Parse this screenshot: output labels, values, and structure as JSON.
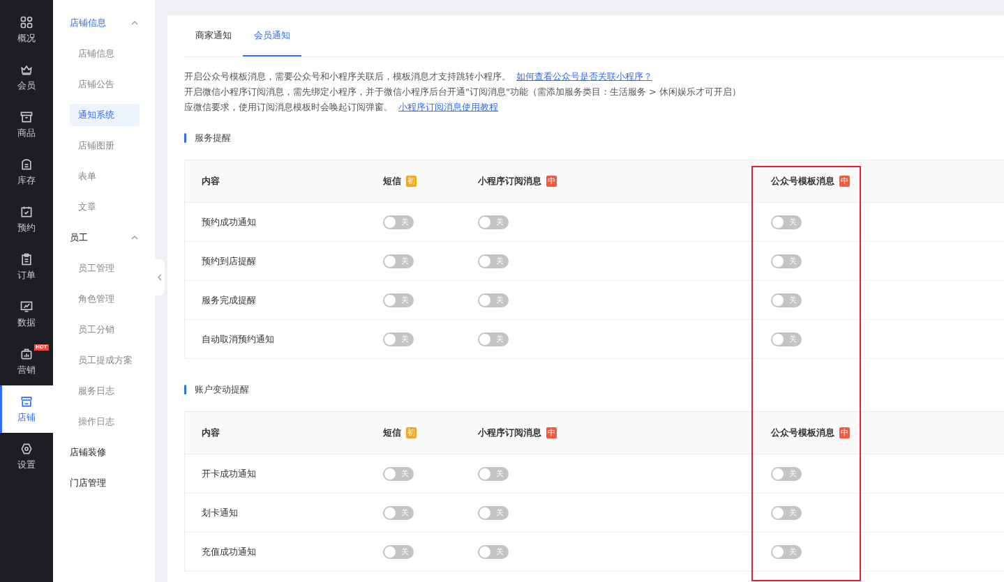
{
  "rail": [
    {
      "label": "概况",
      "selected": false
    },
    {
      "label": "会员",
      "selected": false
    },
    {
      "label": "商品",
      "selected": false
    },
    {
      "label": "库存",
      "selected": false
    },
    {
      "label": "预约",
      "selected": false
    },
    {
      "label": "订单",
      "selected": false
    },
    {
      "label": "数据",
      "selected": false
    },
    {
      "label": "营销",
      "selected": false,
      "badge": "HOT"
    },
    {
      "label": "店铺",
      "selected": true
    },
    {
      "label": "设置",
      "selected": false
    }
  ],
  "submenu": [
    {
      "label": "店铺信息",
      "selected": true,
      "expanded": true,
      "children": [
        {
          "label": "店铺信息",
          "selected": false
        },
        {
          "label": "店铺公告",
          "selected": false
        },
        {
          "label": "通知系统",
          "selected": true
        },
        {
          "label": "店铺图册",
          "selected": false
        },
        {
          "label": "表单",
          "selected": false
        },
        {
          "label": "文章",
          "selected": false
        }
      ]
    },
    {
      "label": "员工",
      "selected": false,
      "expanded": true,
      "children": [
        {
          "label": "员工管理",
          "selected": false
        },
        {
          "label": "角色管理",
          "selected": false
        },
        {
          "label": "员工分销",
          "selected": false
        },
        {
          "label": "员工提成方案",
          "selected": false
        },
        {
          "label": "服务日志",
          "selected": false
        },
        {
          "label": "操作日志",
          "selected": false
        }
      ]
    },
    {
      "label": "店铺装修",
      "selected": false
    },
    {
      "label": "门店管理",
      "selected": false
    }
  ],
  "tabs": [
    {
      "label": "商家通知",
      "selected": false
    },
    {
      "label": "会员通知",
      "selected": true
    }
  ],
  "notices": [
    {
      "text": "开启公众号模板消息，需要公众号和小程序关联后，模板消息才支持跳转小程序。",
      "link": "如何查看公众号是否关联小程序？"
    },
    {
      "text": "开启微信小程序订阅消息，需先绑定小程序，并于微信小程序后台开通\"订阅消息\"功能（需添加服务类目：生活服务 > 休闲娱乐才可开启）"
    },
    {
      "text": "应微信要求，使用订阅消息模板时会唤起订阅弹窗。",
      "link": "小程序订阅消息使用教程"
    }
  ],
  "sections": [
    {
      "title": "服务提醒",
      "columns": [
        {
          "label": "内容"
        },
        {
          "label": "短信",
          "badge": "初",
          "color": "#f5a623"
        },
        {
          "label": "小程序订阅消息",
          "badge": "中",
          "color": "#f5583a"
        },
        {
          "label": "公众号模板消息",
          "badge": "中",
          "color": "#f5583a"
        }
      ],
      "rows": [
        {
          "name": "预约成功通知",
          "toggles": [
            {
              "on": false,
              "label": "关"
            },
            {
              "on": false,
              "label": "关"
            },
            {
              "on": false,
              "label": "关"
            }
          ]
        },
        {
          "name": "预约到店提醒",
          "toggles": [
            {
              "on": false,
              "label": "关"
            },
            {
              "on": false,
              "label": "关"
            },
            {
              "on": false,
              "label": "关"
            }
          ]
        },
        {
          "name": "服务完成提醒",
          "toggles": [
            {
              "on": false,
              "label": "关"
            },
            {
              "on": false,
              "label": "关"
            },
            {
              "on": false,
              "label": "关"
            }
          ]
        },
        {
          "name": "自动取消预约通知",
          "toggles": [
            {
              "on": false,
              "label": "关"
            },
            {
              "on": false,
              "label": "关"
            },
            {
              "on": false,
              "label": "关"
            }
          ]
        }
      ]
    },
    {
      "title": "账户变动提醒",
      "columns": [
        {
          "label": "内容"
        },
        {
          "label": "短信",
          "badge": "初",
          "color": "#f5a623"
        },
        {
          "label": "小程序订阅消息",
          "badge": "中",
          "color": "#f5583a"
        },
        {
          "label": "公众号模板消息",
          "badge": "中",
          "color": "#f5583a"
        }
      ],
      "rows": [
        {
          "name": "开卡成功通知",
          "toggles": [
            {
              "on": false,
              "label": "关"
            },
            {
              "on": false,
              "label": "关"
            },
            {
              "on": false,
              "label": "关"
            }
          ]
        },
        {
          "name": "划卡通知",
          "toggles": [
            {
              "on": false,
              "label": "关"
            },
            {
              "on": false,
              "label": "关"
            },
            {
              "on": false,
              "label": "关"
            }
          ]
        },
        {
          "name": "充值成功通知",
          "toggles": [
            {
              "on": false,
              "label": "关"
            },
            {
              "on": false,
              "label": "关"
            },
            {
              "on": false,
              "label": "关"
            }
          ]
        }
      ]
    }
  ]
}
